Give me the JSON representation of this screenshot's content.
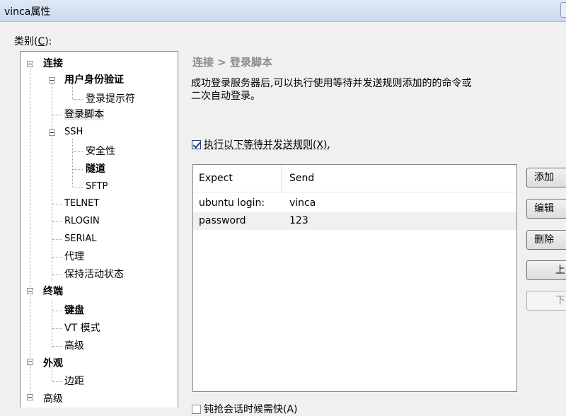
{
  "window": {
    "title": "vinca属性"
  },
  "category": {
    "label": "类别(",
    "key": "C",
    "label_end": "):"
  },
  "tree": {
    "items": [
      {
        "label": "连接",
        "bold": true
      },
      {
        "label": "用户身份验证",
        "bold": true
      },
      {
        "label": "登录提示符",
        "bold": false
      },
      {
        "label": "登录脚本",
        "bold": false,
        "selected": true
      },
      {
        "label": "SSH",
        "bold": false
      },
      {
        "label": "安全性",
        "bold": false
      },
      {
        "label": "隧道",
        "bold": true
      },
      {
        "label": "SFTP",
        "bold": false
      },
      {
        "label": "TELNET",
        "bold": false
      },
      {
        "label": "RLOGIN",
        "bold": false
      },
      {
        "label": "SERIAL",
        "bold": false
      },
      {
        "label": "代理",
        "bold": false
      },
      {
        "label": "保持活动状态",
        "bold": false
      },
      {
        "label": "终端",
        "bold": true
      },
      {
        "label": "键盘",
        "bold": true
      },
      {
        "label": "VT 模式",
        "bold": false
      },
      {
        "label": "高级",
        "bold": false
      },
      {
        "label": "外观",
        "bold": true
      },
      {
        "label": "边距",
        "bold": false
      },
      {
        "label": "高级",
        "bold": false
      }
    ]
  },
  "main": {
    "breadcrumb": "连接 > 登录脚本",
    "description_line1": "成功登录服务器后,可以执行使用等待并发送规则添加的的命令或",
    "description_line2": "二次自动登录。",
    "enable_rules": {
      "label": "执行以下等待并发送规则(X).",
      "checked": true
    },
    "table": {
      "headers": [
        "Expect",
        "Send"
      ],
      "rows": [
        {
          "expect": "ubuntu login:",
          "send": "vinca"
        },
        {
          "expect": "password",
          "send": "123"
        }
      ]
    },
    "buttons": {
      "add": "添加",
      "edit": "编辑",
      "delete": "删除",
      "up": "上",
      "down": "下"
    },
    "bottom_option": {
      "label": "钝抢会话时候需快(A)",
      "checked": false
    }
  },
  "colors": {
    "titlebar": "#c9d9ee",
    "selection": "#e8e8e8",
    "checkbox": "#1e3e73"
  }
}
